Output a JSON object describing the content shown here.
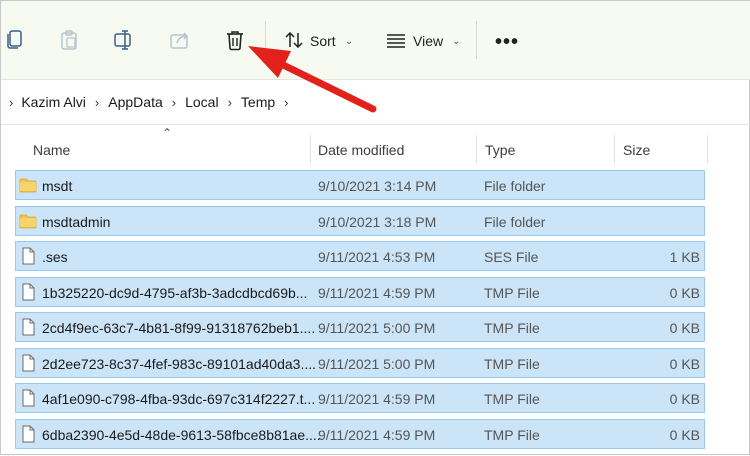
{
  "toolbar": {
    "sort_label": "Sort",
    "view_label": "View",
    "more_label": "•••",
    "icons": [
      "copy-icon",
      "paste-icon",
      "rename-icon",
      "share-icon",
      "delete-icon",
      "sort-icon",
      "view-icon"
    ]
  },
  "breadcrumb": {
    "segments": [
      "Kazim Alvi",
      "AppData",
      "Local",
      "Temp"
    ]
  },
  "columns": {
    "name": "Name",
    "date": "Date modified",
    "type": "Type",
    "size": "Size"
  },
  "files": [
    {
      "name": "msdt",
      "date": "9/10/2021 3:14 PM",
      "type": "File folder",
      "size": "",
      "kind": "folder"
    },
    {
      "name": "msdtadmin",
      "date": "9/10/2021 3:18 PM",
      "type": "File folder",
      "size": "",
      "kind": "folder"
    },
    {
      "name": ".ses",
      "date": "9/11/2021 4:53 PM",
      "type": "SES File",
      "size": "1 KB",
      "kind": "file"
    },
    {
      "name": "1b325220-dc9d-4795-af3b-3adcdbcd69b...",
      "date": "9/11/2021 4:59 PM",
      "type": "TMP File",
      "size": "0 KB",
      "kind": "file"
    },
    {
      "name": "2cd4f9ec-63c7-4b81-8f99-91318762beb1....",
      "date": "9/11/2021 5:00 PM",
      "type": "TMP File",
      "size": "0 KB",
      "kind": "file"
    },
    {
      "name": "2d2ee723-8c37-4fef-983c-89101ad40da3....",
      "date": "9/11/2021 5:00 PM",
      "type": "TMP File",
      "size": "0 KB",
      "kind": "file"
    },
    {
      "name": "4af1e090-c798-4fba-93dc-697c314f2227.t...",
      "date": "9/11/2021 4:59 PM",
      "type": "TMP File",
      "size": "0 KB",
      "kind": "file"
    },
    {
      "name": "6dba2390-4e5d-48de-9613-58fbce8b81ae....",
      "date": "9/11/2021 4:59 PM",
      "type": "TMP File",
      "size": "0 KB",
      "kind": "file"
    }
  ],
  "colors": {
    "selection_bg": "#cce4f7",
    "selection_border": "#99c8ec",
    "annotation_arrow": "#e3211c",
    "folder": "#f2c24b"
  }
}
